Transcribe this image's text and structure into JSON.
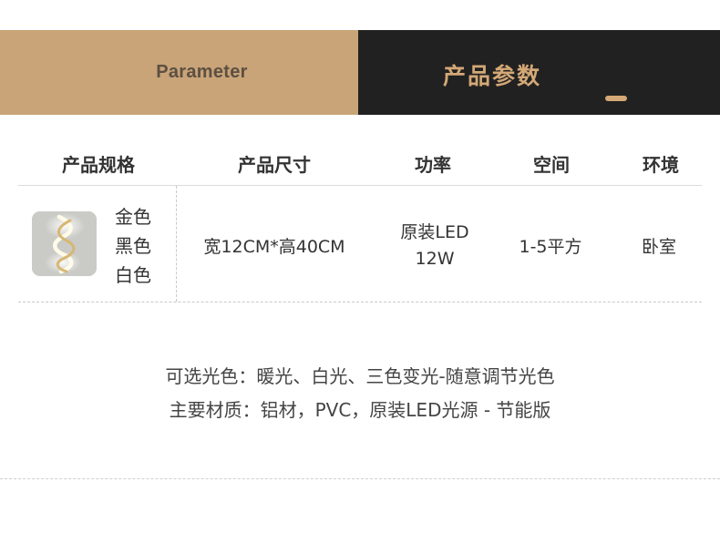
{
  "banner": {
    "left_label": "Parameter",
    "right_title": "产品参数"
  },
  "table": {
    "headers": [
      "产品规格",
      "产品尺寸",
      "功率",
      "空间",
      "环境"
    ],
    "row": {
      "colors": [
        "金色",
        "黑色",
        "白色"
      ],
      "size": "宽12CM*高40CM",
      "power_line1": "原装LED",
      "power_line2": "12W",
      "space": "1-5平方",
      "environment": "卧室"
    }
  },
  "notes": [
    "可选光色：暖光、白光、三色变光-随意调节光色",
    "主要材质：铝材，PVC，原装LED光源 - 节能版"
  ],
  "colors": {
    "banner_tan": "#c8a478",
    "banner_dark": "#212121",
    "title_gold": "#d4a876"
  }
}
